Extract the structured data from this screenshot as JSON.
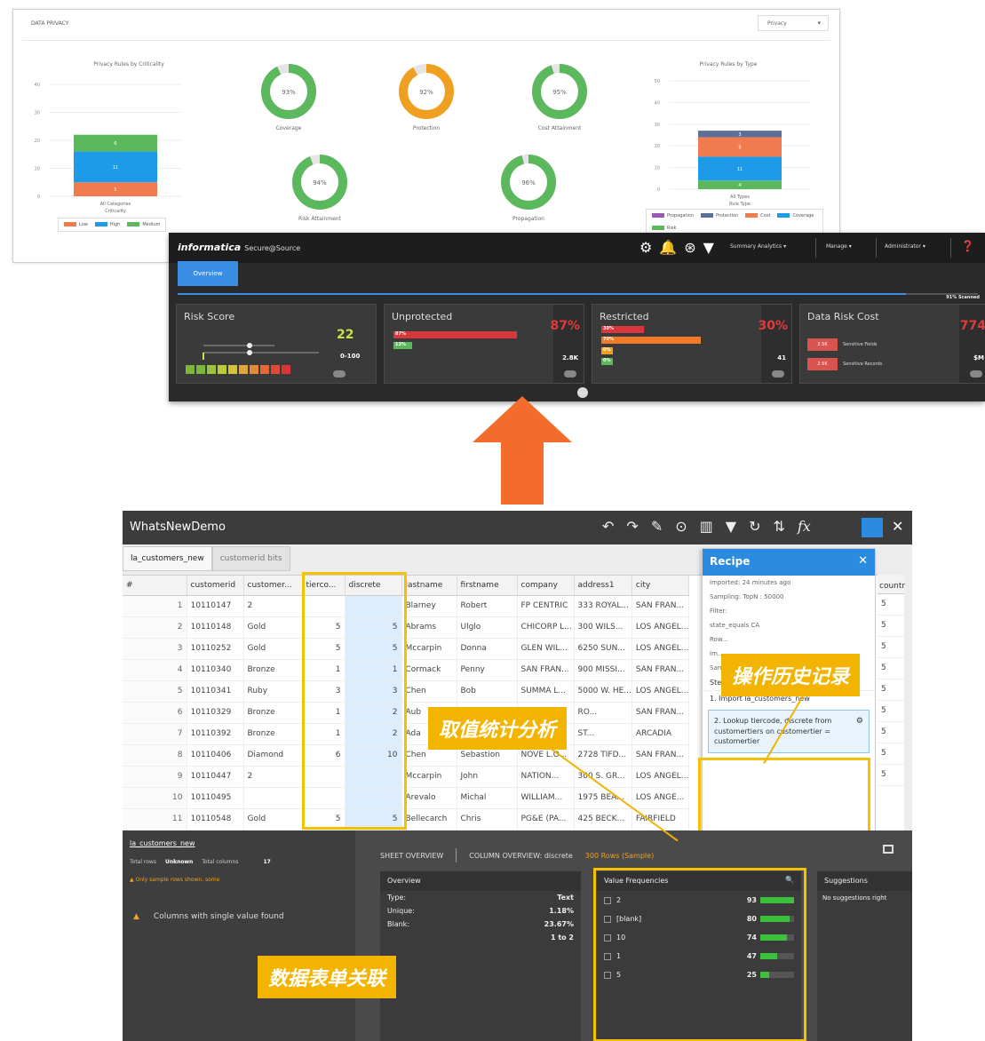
{
  "privacy": {
    "title": "DATA PRIVACY",
    "select_value": "Privacy",
    "criticality_chart": {
      "title": "Privacy Rules by Criticality",
      "ticks": [
        "40",
        "30",
        "20",
        "10",
        "0"
      ],
      "xlabel": "All Categories",
      "xsub": "Criticality",
      "segments": [
        {
          "label": "6",
          "value": 6,
          "color": "#5cb85c"
        },
        {
          "label": "11",
          "value": 11,
          "color": "#1e9be8"
        },
        {
          "label": "5",
          "value": 5,
          "color": "#f07b4f"
        }
      ],
      "legend": [
        {
          "name": "Low",
          "color": "#f07b4f"
        },
        {
          "name": "High",
          "color": "#1e9be8"
        },
        {
          "name": "Medium",
          "color": "#5cb85c"
        }
      ]
    },
    "donuts": [
      {
        "pct_label": "93%",
        "pct": 93,
        "label": "Coverage",
        "color": "#5cb85c"
      },
      {
        "pct_label": "92%",
        "pct": 92,
        "label": "Protection",
        "color": "#f0a020"
      },
      {
        "pct_label": "95%",
        "pct": 95,
        "label": "Cost Attainment",
        "color": "#5cb85c"
      },
      {
        "pct_label": "94%",
        "pct": 94,
        "label": "Risk Attainment",
        "color": "#5cb85c"
      },
      {
        "pct_label": "96%",
        "pct": 96,
        "label": "Propagation",
        "color": "#5cb85c"
      }
    ],
    "type_chart": {
      "title": "Privacy Rules by Type",
      "ticks": [
        "50",
        "40",
        "30",
        "20",
        "10",
        "0"
      ],
      "xlabel": "All Types",
      "xsub": "Rule Type",
      "segments": [
        {
          "label": "3",
          "value": 3,
          "color": "#5b6f9a"
        },
        {
          "label": "9",
          "value": 9,
          "color": "#f07b4f"
        },
        {
          "label": "11",
          "value": 11,
          "color": "#1e9be8"
        },
        {
          "label": "4",
          "value": 4,
          "color": "#5cb85c"
        }
      ],
      "legend": [
        {
          "name": "Propagation",
          "color": "#9b59b6"
        },
        {
          "name": "Protection",
          "color": "#5b6f9a"
        },
        {
          "name": "Cost",
          "color": "#f07b4f"
        },
        {
          "name": "Coverage",
          "color": "#1e9be8"
        },
        {
          "name": "Risk",
          "color": "#5cb85c"
        }
      ]
    }
  },
  "secure": {
    "brand": "informatica",
    "product": "Secure@Source",
    "menus": [
      "Summary Analytics",
      "Manage",
      "Administrator"
    ],
    "tab": "Overview",
    "scanned_label": "91% Scanned",
    "scanned_pct": 91,
    "cards": {
      "risk": {
        "title": "Risk Score",
        "value": "22",
        "range": "0-100"
      },
      "unprotected": {
        "title": "Unprotected",
        "pct": "87%",
        "count": "2.8K",
        "bars": [
          {
            "label": "87%",
            "pct": 87,
            "color": "#d9363e"
          },
          {
            "label": "13%",
            "pct": 13,
            "color": "#5cb85c"
          }
        ]
      },
      "restricted": {
        "title": "Restricted",
        "pct": "30%",
        "count": "41",
        "bars": [
          {
            "label": "30%",
            "pct": 30,
            "color": "#d9363e"
          },
          {
            "label": "70%",
            "pct": 70,
            "color": "#f07b2a"
          },
          {
            "label": "0%",
            "pct": 2,
            "color": "#f0a020"
          },
          {
            "label": "0%",
            "pct": 2,
            "color": "#5cb85c"
          }
        ]
      },
      "cost": {
        "title": "Data Risk Cost",
        "value": "774",
        "unit": "$M",
        "rows": [
          {
            "chip": "2.5K",
            "text": "Sensitive Fields"
          },
          {
            "chip": "2.5K",
            "text": "Sensitive Records"
          }
        ]
      }
    }
  },
  "prep": {
    "title": "WhatsNewDemo",
    "tabs": [
      "la_customers_new",
      "customerid bits"
    ],
    "columns": [
      "#",
      "customerid",
      "customer...",
      "tierco...",
      "discrete",
      "lastname",
      "firstname",
      "company",
      "address1",
      "city"
    ],
    "rows": [
      {
        "n": "1",
        "customerid": "10110147",
        "customer": "2",
        "tier": "",
        "disc": "",
        "last": "Blarney",
        "first": "Robert",
        "company": "FP CENTRIC",
        "addr": "333 ROYAL...",
        "city": "SAN FRAN..."
      },
      {
        "n": "2",
        "customerid": "10110148",
        "customer": "Gold",
        "tier": "5",
        "disc": "5",
        "last": "Abrams",
        "first": "Ulglo",
        "company": "CHICORP L...",
        "addr": "300 WILS...",
        "city": "LOS ANGEL..."
      },
      {
        "n": "3",
        "customerid": "10110252",
        "customer": "Gold",
        "tier": "5",
        "disc": "5",
        "last": "Mccarpin",
        "first": "Donna",
        "company": "GLEN WIL...",
        "addr": "6250 SUN...",
        "city": "LOS ANGEL..."
      },
      {
        "n": "4",
        "customerid": "10110340",
        "customer": "Bronze",
        "tier": "1",
        "disc": "1",
        "last": "Cormack",
        "first": "Penny",
        "company": "SAN FRAN...",
        "addr": "900 MISSI...",
        "city": "SAN FRAN..."
      },
      {
        "n": "5",
        "customerid": "10110341",
        "customer": "Ruby",
        "tier": "3",
        "disc": "3",
        "last": "Chen",
        "first": "Bob",
        "company": "SUMMA L...",
        "addr": "5000 W. HE...",
        "city": "LOS ANGEL..."
      },
      {
        "n": "6",
        "customerid": "10110329",
        "customer": "Bronze",
        "tier": "1",
        "disc": "2",
        "last": "Aub",
        "first": "",
        "company": "",
        "addr": "RO...",
        "city": "SAN FRAN..."
      },
      {
        "n": "7",
        "customerid": "10110392",
        "customer": "Bronze",
        "tier": "1",
        "disc": "2",
        "last": "Ada",
        "first": "",
        "company": "",
        "addr": "ST...",
        "city": "ARCADIA"
      },
      {
        "n": "8",
        "customerid": "10110406",
        "customer": "Diamond",
        "tier": "6",
        "disc": "10",
        "last": "Chen",
        "first": "Sebastion",
        "company": "NOVE L.O...",
        "addr": "2728 TIFD...",
        "city": "SAN FRAN..."
      },
      {
        "n": "9",
        "customerid": "10110447",
        "customer": "2",
        "tier": "",
        "disc": "",
        "last": "Mccarpin",
        "first": "John",
        "company": "NATION...",
        "addr": "300 S. GR...",
        "city": "LOS ANGEL..."
      },
      {
        "n": "10",
        "customerid": "10110495",
        "customer": "",
        "tier": "",
        "disc": "",
        "last": "Arevalo",
        "first": "Michal",
        "company": "WILLIAM...",
        "addr": "1975 BEA...",
        "city": "LOS ANGE..."
      },
      {
        "n": "11",
        "customerid": "10110548",
        "customer": "Gold",
        "tier": "5",
        "disc": "5",
        "last": "Bellecarch",
        "first": "Chris",
        "company": "PG&E (PA...",
        "addr": "425 BECK...",
        "city": "FAIRFIELD"
      }
    ],
    "extra_col": [
      "5",
      "5",
      "5",
      "5",
      "5",
      "5",
      "5",
      "5",
      "5"
    ],
    "extra_head": "countr",
    "recipe": {
      "title": "Recipe",
      "lines": [
        "Imported: 24 minutes ago",
        "Sampling: TopN : 50000",
        "Filter:",
        "state_equals CA",
        "Row...",
        "Im...",
        "Sampling: TopN : 50000"
      ],
      "steps_label": "Steps",
      "step1": "1. Import la_customers_new",
      "step2": "2. Lookup tiercode, discrete from customertiers on customertier = customertier"
    },
    "bottom": {
      "sheet_name": "la_customers_new",
      "stats": [
        "Total rows",
        "Unknown",
        "Total columns",
        "17"
      ],
      "warn1": "Only sample rows shown, some",
      "warn2": "Columns with single value found",
      "tabs": [
        "SHEET OVERVIEW",
        "COLUMN OVERVIEW: discrete",
        "300 Rows (Sample)"
      ],
      "overview": {
        "head": "Overview",
        "rows": [
          {
            "k": "Type:",
            "v": "Text"
          },
          {
            "k": "Unique:",
            "v": "1.18%"
          },
          {
            "k": "Blank:",
            "v": "23.67%"
          },
          {
            "k": "",
            "v": "1 to 2"
          }
        ]
      },
      "value_freq": {
        "head": "Value Frequencies",
        "rows": [
          {
            "v": "2",
            "c": "93",
            "pct": 100
          },
          {
            "v": "[blank]",
            "c": "80",
            "pct": 86
          },
          {
            "v": "10",
            "c": "74",
            "pct": 80
          },
          {
            "v": "1",
            "c": "47",
            "pct": 51
          },
          {
            "v": "5",
            "c": "25",
            "pct": 27
          }
        ]
      },
      "suggestions": {
        "head": "Suggestions",
        "text": "No suggestions right"
      }
    }
  },
  "annotations": {
    "history": "操作历史记录",
    "stats": "取值统计分析",
    "join": "数据表单关联"
  }
}
